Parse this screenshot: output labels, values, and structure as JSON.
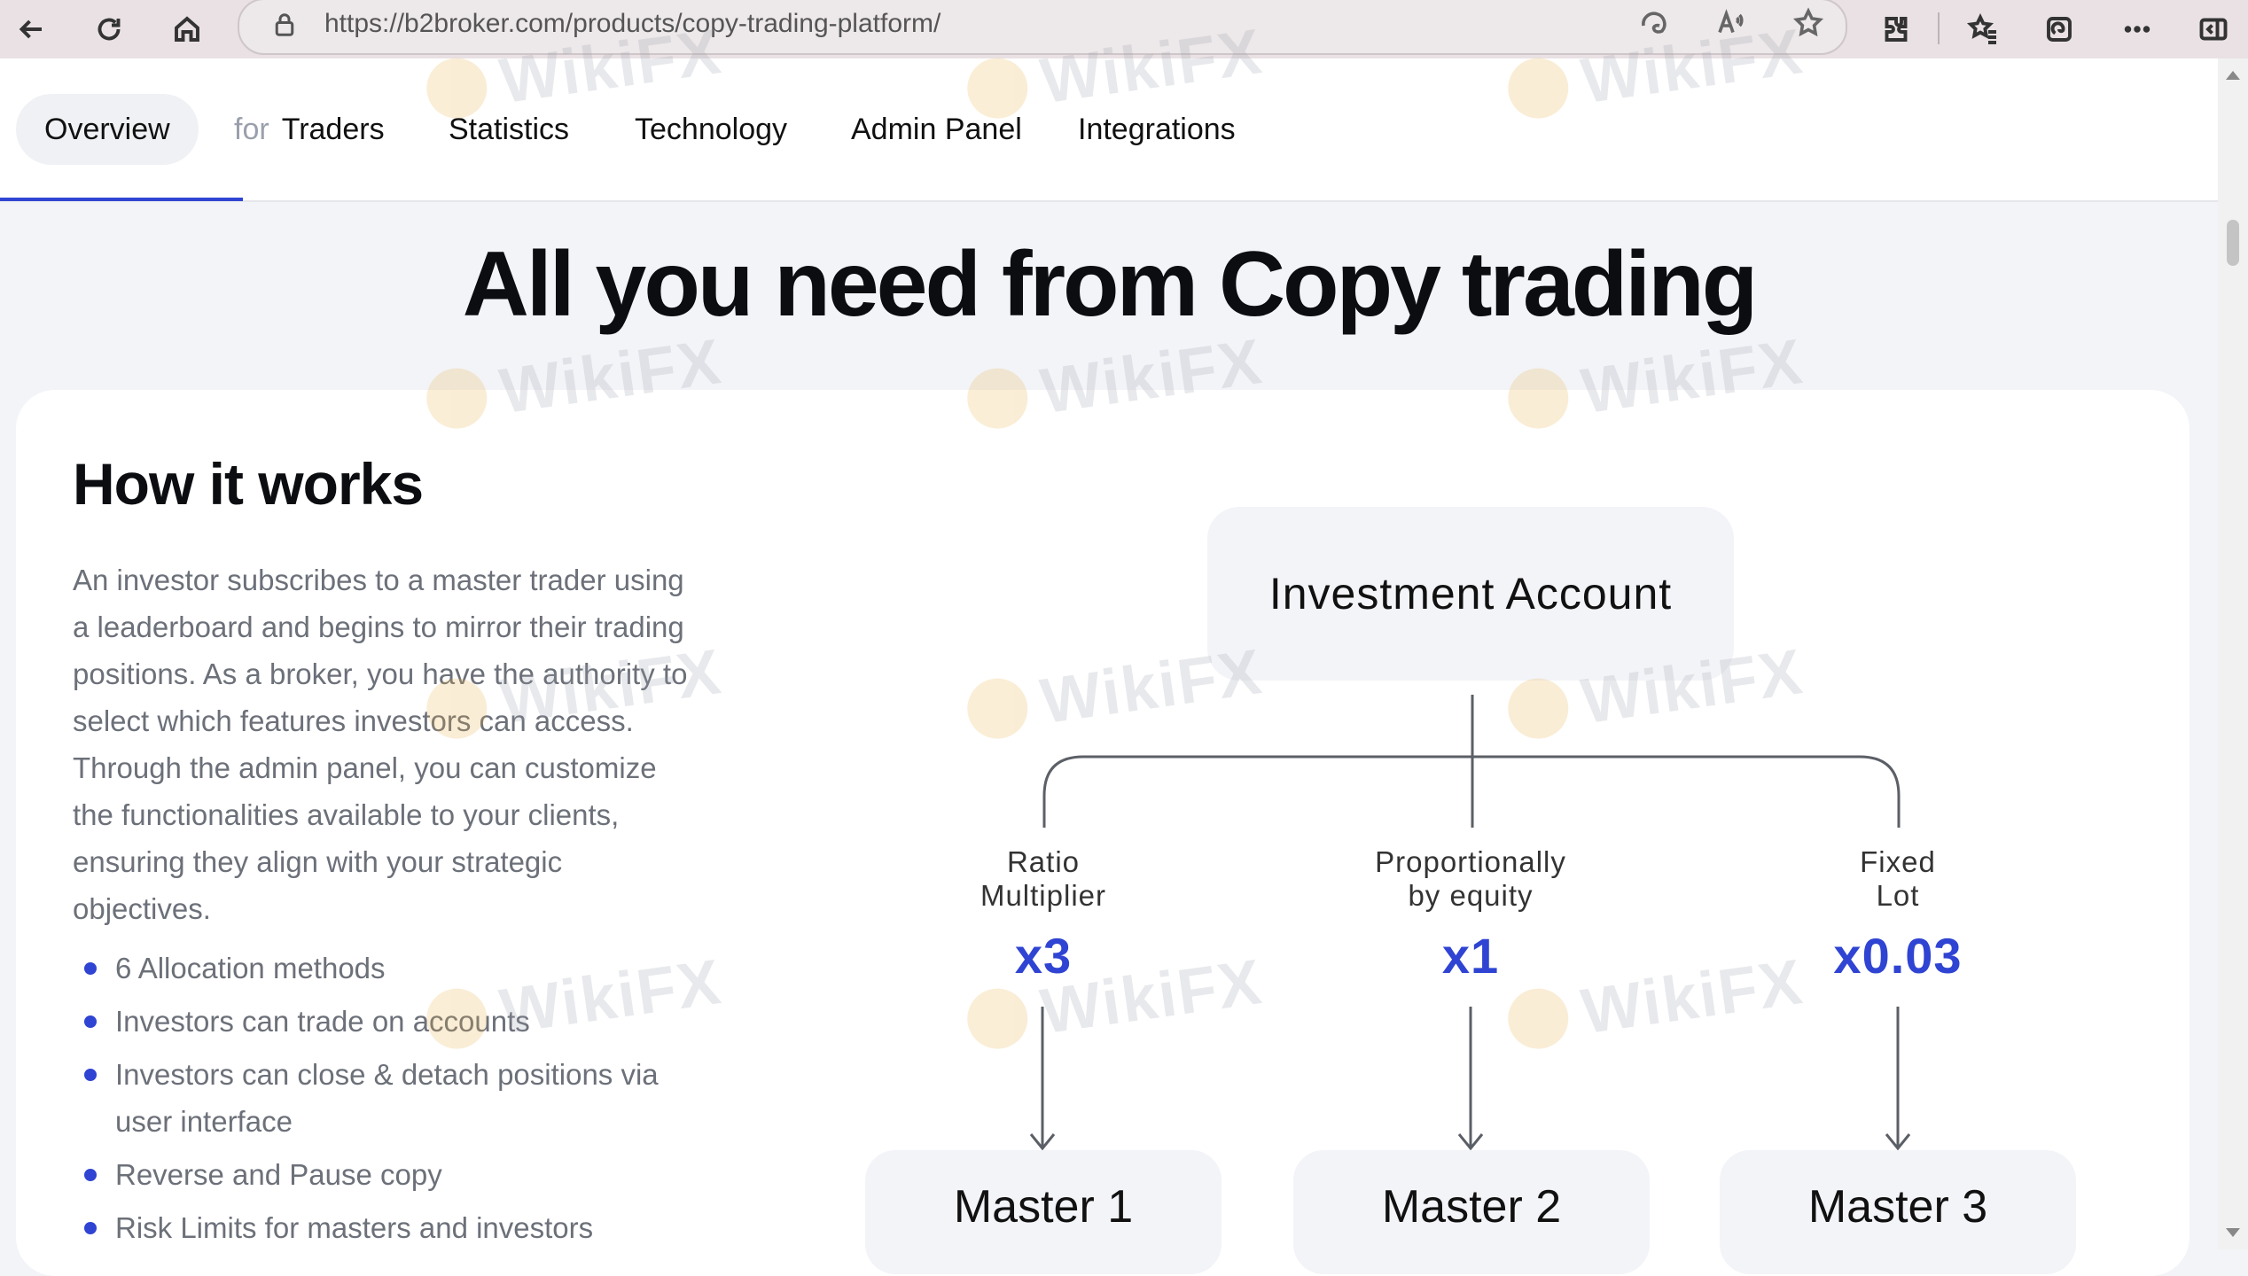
{
  "browser": {
    "url": "https://b2broker.com/products/copy-trading-platform/",
    "icons": [
      "back-arrow-icon",
      "refresh-icon",
      "home-icon",
      "lock-icon",
      "edge-icon",
      "read-aloud-icon",
      "star-icon",
      "extensions-icon",
      "favorites-icon",
      "collections-icon",
      "more-icon",
      "sidebar-icon"
    ]
  },
  "nav": {
    "tabs": [
      {
        "label": "Overview"
      },
      {
        "prefix": "for",
        "label": "Traders"
      },
      {
        "label": "Statistics"
      },
      {
        "label": "Technology"
      },
      {
        "label": "Admin Panel"
      },
      {
        "label": "Integrations"
      }
    ]
  },
  "hero": {
    "title": "All you need from Copy trading"
  },
  "how": {
    "title": "How it works",
    "description": "An investor subscribes to a master trader using a leaderboard and begins to mirror their trading positions. As a broker, you have the authority to select which features investors can access. Through the admin panel, you can customize the functionalities available to your clients, ensuring they align with your strategic objectives.",
    "bullets": [
      "6 Allocation methods",
      "Investors can trade on accounts",
      "Investors can close & detach positions via user interface",
      "Reverse and Pause copy",
      "Risk Limits for masters and investors"
    ]
  },
  "diagram": {
    "root": "Investment Account",
    "branches": [
      {
        "line1": "Ratio",
        "line2": "Multiplier",
        "value": "x3",
        "master": "Master 1"
      },
      {
        "line1": "Proportionally",
        "line2": "by equity",
        "value": "x1",
        "master": "Master 2"
      },
      {
        "line1": "Fixed",
        "line2": "Lot",
        "value": "x0.03",
        "master": "Master 3"
      }
    ]
  },
  "watermark": {
    "text": "WikiFX"
  },
  "colors": {
    "accent": "#2f44d2",
    "card": "#ffffff",
    "page": "#f3f4f8"
  }
}
